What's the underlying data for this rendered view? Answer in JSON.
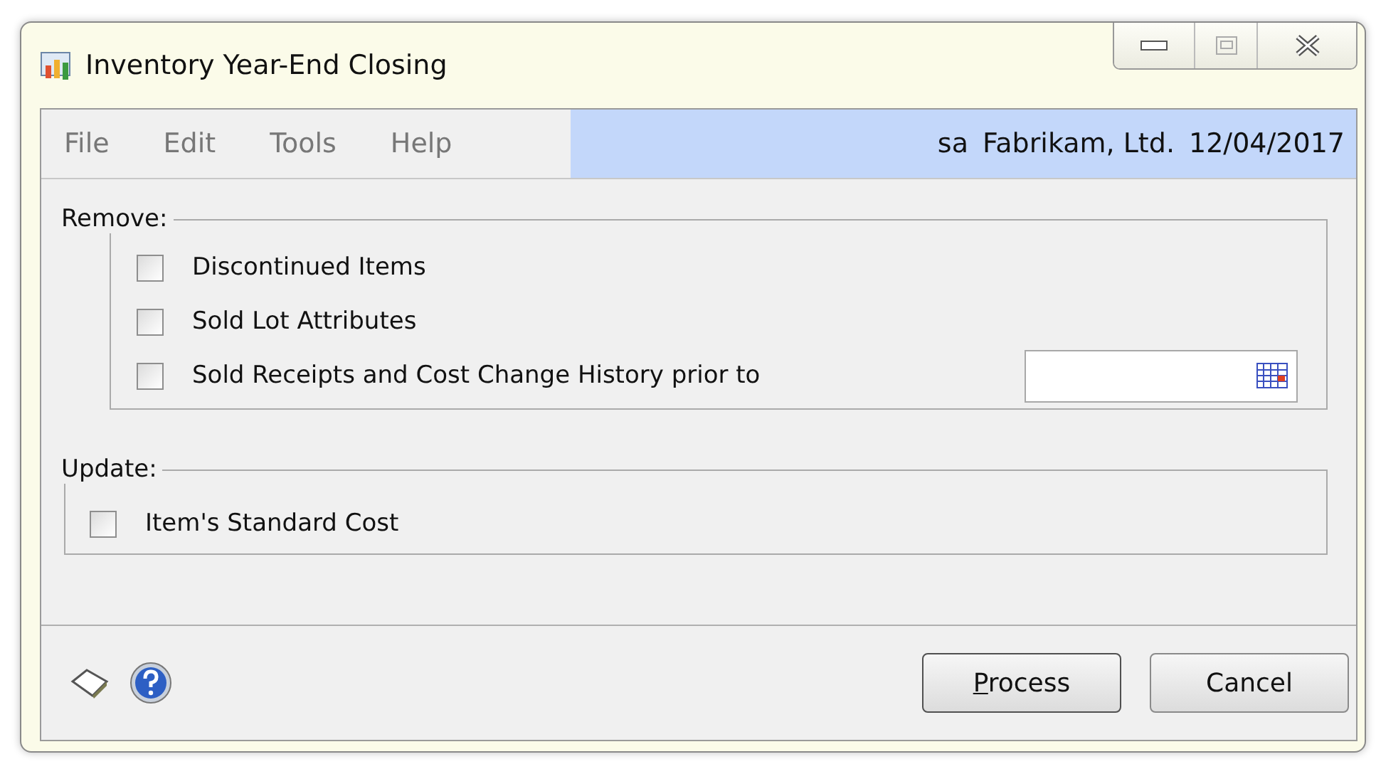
{
  "window": {
    "title": "Inventory Year-End Closing"
  },
  "menu": [
    "File",
    "Edit",
    "Tools",
    "Help"
  ],
  "status": {
    "user": "sa",
    "company": "Fabrikam, Ltd.",
    "date": "12/04/2017"
  },
  "remove": {
    "label": "Remove:",
    "options": [
      {
        "label": "Discontinued Items",
        "checked": false
      },
      {
        "label": "Sold Lot Attributes",
        "checked": false
      },
      {
        "label": "Sold Receipts and Cost Change History prior to",
        "checked": false,
        "kind": "date"
      }
    ]
  },
  "update": {
    "label": "Update:",
    "options": [
      {
        "label": "Item's Standard Cost",
        "checked": false
      }
    ]
  },
  "buttons": [
    {
      "label": "Process",
      "default": true
    },
    {
      "label": "Cancel",
      "default": false
    }
  ]
}
